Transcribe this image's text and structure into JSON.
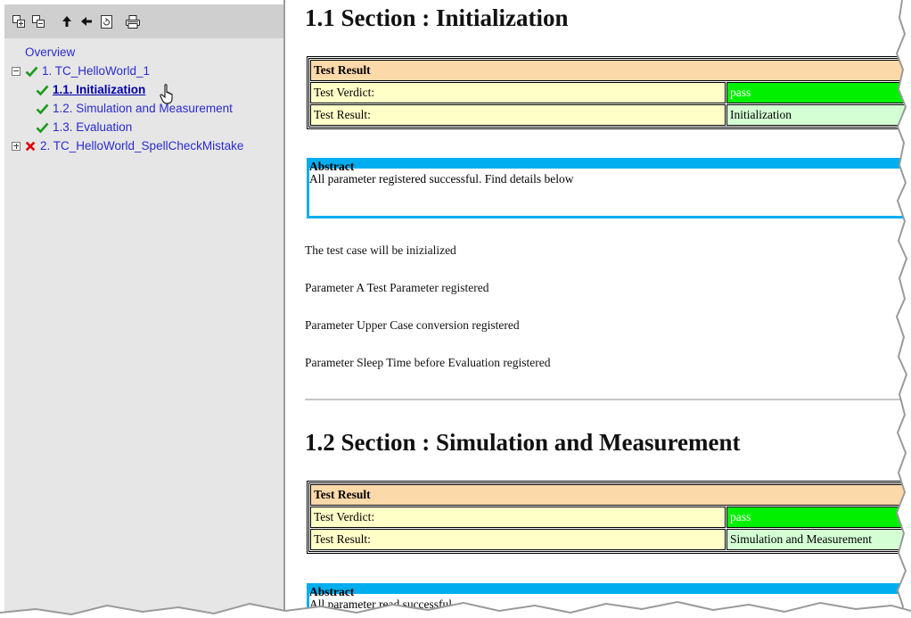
{
  "toolbar": {
    "buttons": [
      "expand-all-icon",
      "collapse-all-icon",
      "arrow-up-icon",
      "arrow-left-icon",
      "refresh-icon",
      "print-icon"
    ]
  },
  "tree": {
    "overview": "Overview",
    "tc1": {
      "label": "1. TC_HelloWorld_1",
      "status": "pass"
    },
    "tc1_children": [
      {
        "label": "1.1. Initialization",
        "status": "pass",
        "current": true
      },
      {
        "label": "1.2. Simulation and Measurement",
        "status": "pass"
      },
      {
        "label": "1.3. Evaluation",
        "status": "pass"
      }
    ],
    "tc2": {
      "label": "2. TC_HelloWorld_SpellCheckMistake",
      "status": "fail"
    }
  },
  "section1": {
    "title": "1.1 Section : Initialization",
    "result_head": "Test Result",
    "verdict_label": "Test Verdict:",
    "verdict_value": "pass",
    "result_label": "Test Result:",
    "result_value": "Initialization",
    "abstract_title": "Abstract",
    "abstract_body": "All parameter registered successful. Find details below",
    "details": [
      "The test case will be inizialized",
      "Parameter A Test Parameter registered",
      "Parameter Upper Case conversion registered",
      "Parameter Sleep Time before Evaluation registered"
    ]
  },
  "section2": {
    "title": "1.2 Section : Simulation and Measurement",
    "result_head": "Test Result",
    "verdict_label": "Test Verdict:",
    "verdict_value": "pass",
    "result_label": "Test Result:",
    "result_value": "Simulation and Measurement",
    "abstract_title": "Abstract",
    "abstract_body": "All parameter read successful"
  },
  "colors": {
    "pass_green": "#00f000",
    "fail_red": "#e00000",
    "result_header": "#fcd9a9",
    "label_cell": "#ffffc8",
    "value_cell": "#d4ffd4",
    "abstract_blue": "#00aeef",
    "link_blue": "#2b2bd0"
  }
}
